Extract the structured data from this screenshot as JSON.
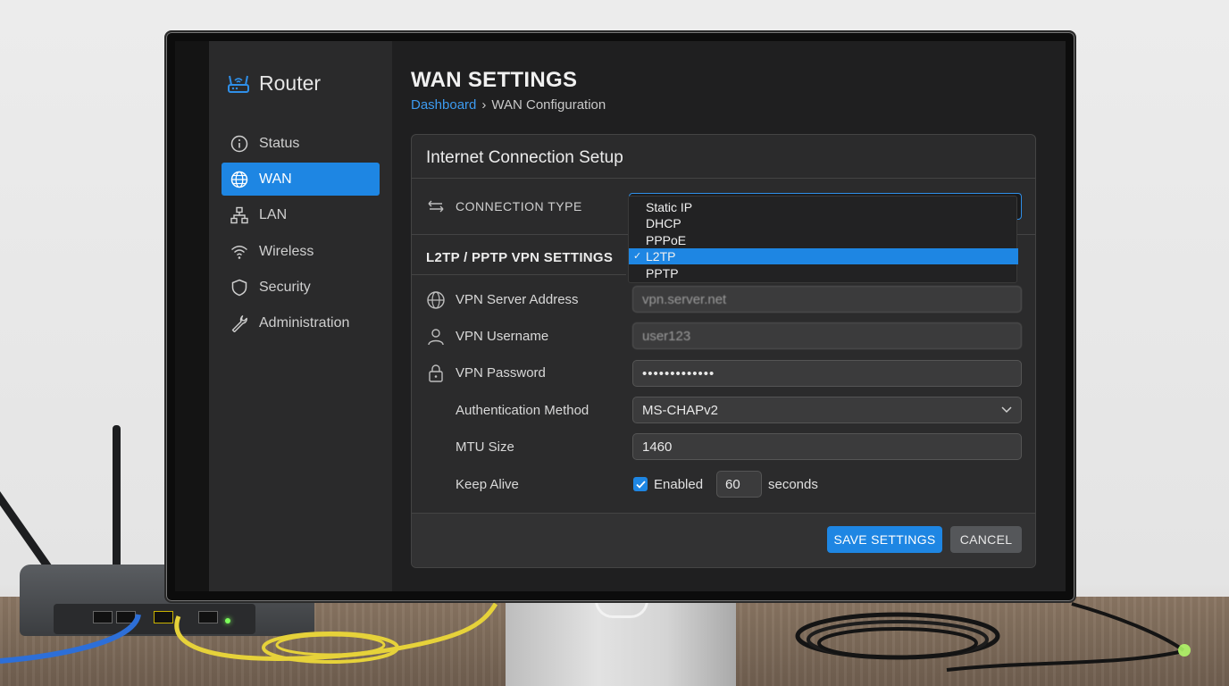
{
  "app": {
    "brand": "Router"
  },
  "sidebar": {
    "items": [
      {
        "label": "Status",
        "icon": "info-icon",
        "active": false
      },
      {
        "label": "WAN",
        "icon": "globe-icon",
        "active": true
      },
      {
        "label": "LAN",
        "icon": "network-icon",
        "active": false
      },
      {
        "label": "Wireless",
        "icon": "wifi-icon",
        "active": false
      },
      {
        "label": "Security",
        "icon": "shield-icon",
        "active": false
      },
      {
        "label": "Administration",
        "icon": "wrench-icon",
        "active": false
      }
    ]
  },
  "header": {
    "title": "WAN SETTINGS",
    "breadcrumb": {
      "root": "Dashboard",
      "separator": "›",
      "current": "WAN Configuration"
    }
  },
  "card": {
    "title": "Internet Connection Setup",
    "connection_type": {
      "label": "CONNECTION TYPE",
      "options": [
        "Static IP",
        "DHCP",
        "PPPoE",
        "L2TP",
        "PPTP"
      ],
      "selected": "L2TP",
      "check": "✓"
    },
    "vpn_section_title": "L2TP / PPTP VPN SETTINGS",
    "fields": {
      "server_label": "VPN Server Address",
      "server_value": "vpn.server.net",
      "username_label": "VPN Username",
      "username_value": "user123",
      "password_label": "VPN Password",
      "password_value": "•••••••••••••",
      "auth_label": "Authentication Method",
      "auth_value": "MS-CHAPv2",
      "mtu_label": "MTU Size",
      "mtu_value": "1460",
      "keepalive_label": "Keep Alive",
      "keepalive_enabled_label": "Enabled",
      "keepalive_value": "60",
      "keepalive_unit": "seconds"
    },
    "buttons": {
      "save": "SAVE SETTINGS",
      "cancel": "CANCEL"
    }
  },
  "colors": {
    "accent": "#1e86e3",
    "link": "#3d9bf0",
    "panel": "#2b2b2c",
    "sidebar": "#2a2a2b"
  }
}
